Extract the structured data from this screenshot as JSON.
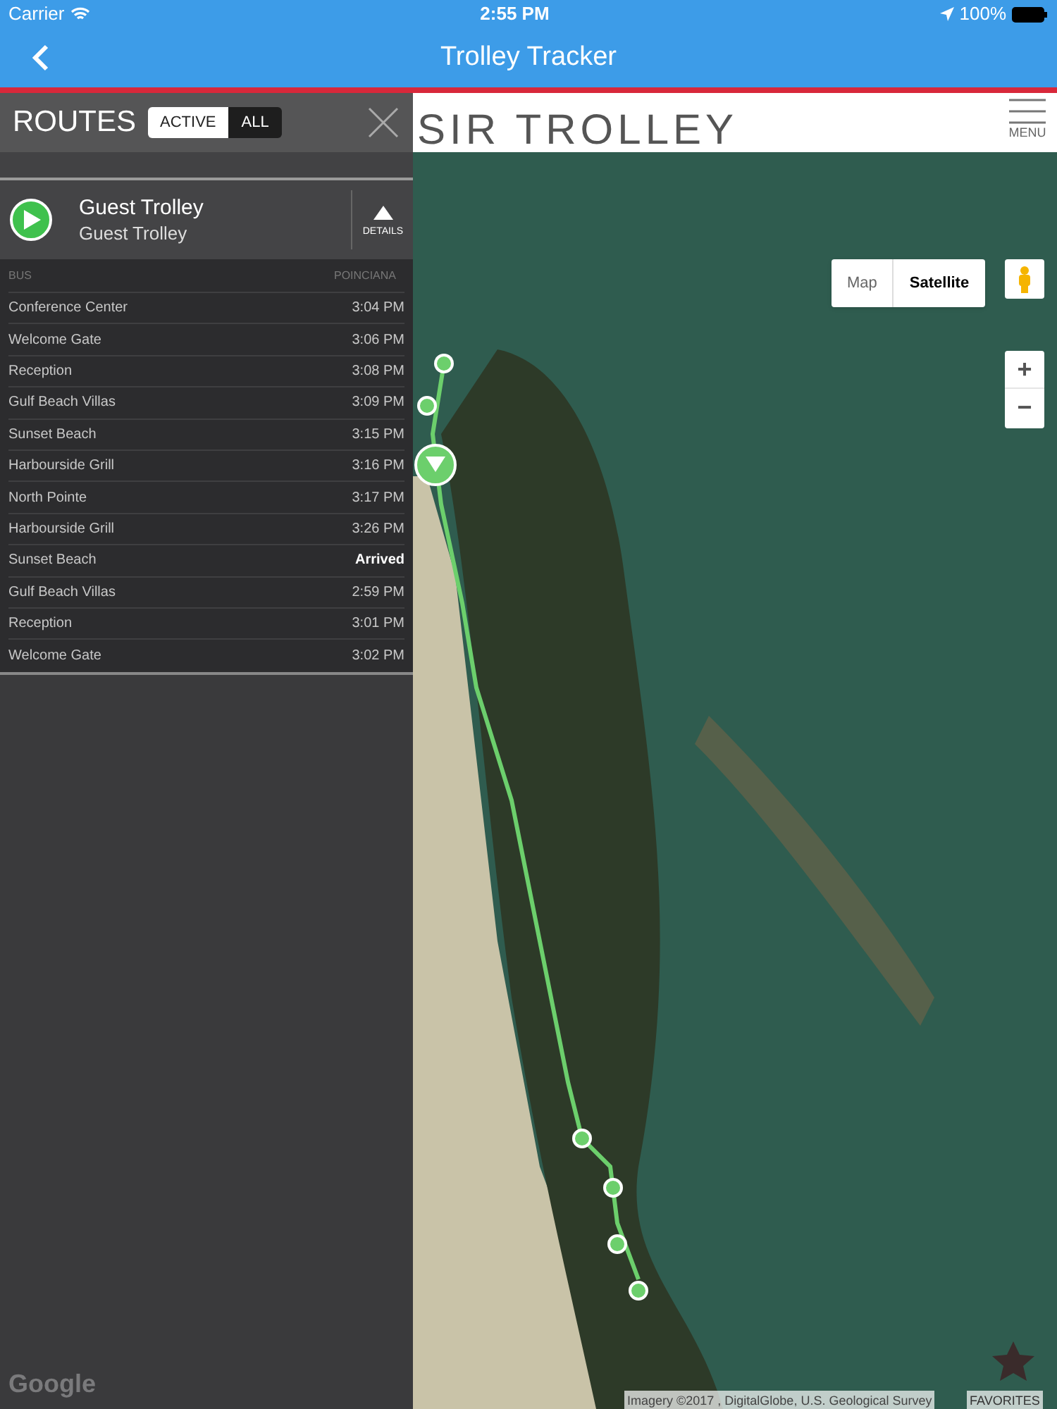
{
  "status_bar": {
    "carrier": "Carrier",
    "time": "2:55 PM",
    "battery": "100%"
  },
  "nav_bar": {
    "title": "Trolley Tracker"
  },
  "header": {
    "brand": "SIR TROLLEY",
    "menu_label": "MENU"
  },
  "routes_panel": {
    "title": "ROUTES",
    "filters": [
      {
        "label": "ACTIVE",
        "selected": true
      },
      {
        "label": "ALL",
        "selected": false
      }
    ],
    "route": {
      "name": "Guest Trolley",
      "subtitle": "Guest Trolley",
      "details_label": "DETAILS",
      "expanded": true
    },
    "table": {
      "columns": [
        "BUS",
        "POINCIANA"
      ],
      "rows": [
        {
          "stop": "Conference Center",
          "time": "3:04 PM",
          "arrived": false
        },
        {
          "stop": "Welcome Gate",
          "time": "3:06 PM",
          "arrived": false
        },
        {
          "stop": "Reception",
          "time": "3:08 PM",
          "arrived": false
        },
        {
          "stop": "Gulf Beach Villas",
          "time": "3:09 PM",
          "arrived": false
        },
        {
          "stop": "Sunset Beach",
          "time": "3:15 PM",
          "arrived": false
        },
        {
          "stop": "Harbourside Grill",
          "time": "3:16 PM",
          "arrived": false
        },
        {
          "stop": "North Pointe",
          "time": "3:17 PM",
          "arrived": false
        },
        {
          "stop": "Harbourside Grill",
          "time": "3:26 PM",
          "arrived": false
        },
        {
          "stop": "Sunset Beach",
          "time": "Arrived",
          "arrived": true
        },
        {
          "stop": "Gulf Beach Villas",
          "time": "2:59 PM",
          "arrived": false
        },
        {
          "stop": "Reception",
          "time": "3:01 PM",
          "arrived": false
        },
        {
          "stop": "Welcome Gate",
          "time": "3:02 PM",
          "arrived": false
        }
      ]
    }
  },
  "map": {
    "map_types": [
      {
        "label": "Map",
        "selected": false
      },
      {
        "label": "Satellite",
        "selected": true
      }
    ],
    "zoom_in": "+",
    "zoom_out": "−",
    "logo": "Google",
    "attribution": "Imagery ©2017 , DigitalGlobe, U.S. Geological Survey",
    "favorites_label": "FAVORITES"
  }
}
